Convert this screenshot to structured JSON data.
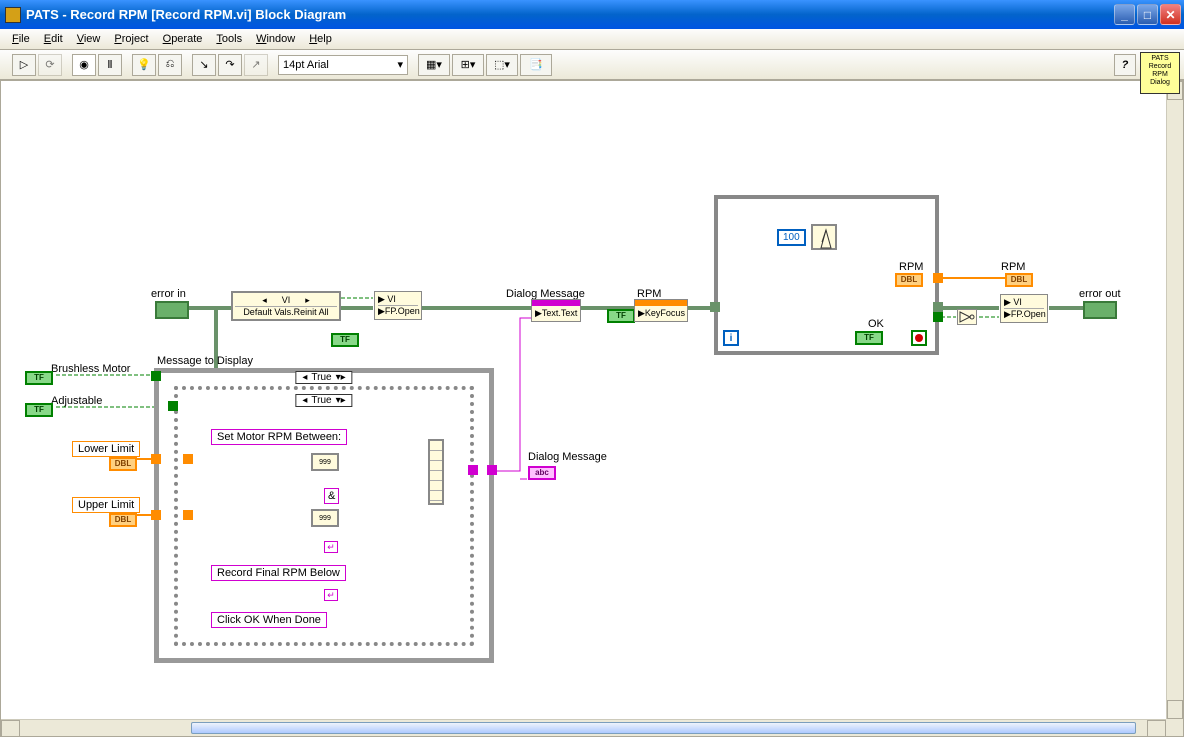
{
  "titlebar": {
    "title": "PATS - Record RPM [Record RPM.vi] Block Diagram"
  },
  "menu": {
    "file": "File",
    "edit": "Edit",
    "view": "View",
    "project": "Project",
    "operate": "Operate",
    "tools": "Tools",
    "window": "Window",
    "help": "Help"
  },
  "toolbar": {
    "font": "14pt Arial"
  },
  "icon_block": "PATS\nRecord\nRPM\nDialog",
  "labels": {
    "error_in": "error in",
    "error_out": "error out",
    "vi": "VI",
    "default_vals": "Default Vals.Reinit All",
    "fp_open": "FP.Open",
    "dialog_message": "Dialog Message",
    "text_text": "Text.Text",
    "rpm": "RPM",
    "key_focus": "KeyFocus",
    "ok": "OK",
    "brushless": "Brushless Motor",
    "adjustable": "Adjustable",
    "lower_limit": "Lower Limit",
    "upper_limit": "Upper Limit",
    "msg_display": "Message to Display",
    "set_motor": "Set Motor RPM Between:",
    "ampersand": "&",
    "record_final": "Record Final RPM Below",
    "click_ok": "Click OK When Done",
    "dialog_msg2": "Dialog Message",
    "case_true": "True",
    "const_100": "100",
    "tf": "TF",
    "dbl": "DBL",
    "abc": "abc",
    "num999": "999"
  }
}
